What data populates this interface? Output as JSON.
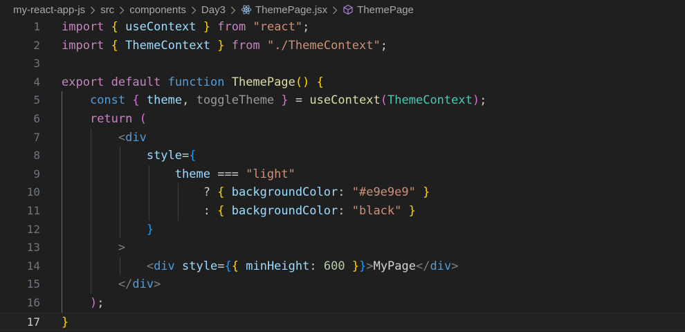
{
  "breadcrumb": {
    "items": [
      "my-react-app-js",
      "src",
      "components",
      "Day3",
      "ThemePage.jsx",
      "ThemePage"
    ]
  },
  "editor": {
    "current_line": 17,
    "lines": [
      {
        "num": "1",
        "tokens": [
          [
            "kw",
            "import"
          ],
          [
            "txt",
            " "
          ],
          [
            "b1",
            "{"
          ],
          [
            "txt",
            " "
          ],
          [
            "var",
            "useContext"
          ],
          [
            "txt",
            " "
          ],
          [
            "b1",
            "}"
          ],
          [
            "txt",
            " "
          ],
          [
            "kw",
            "from"
          ],
          [
            "txt",
            " "
          ],
          [
            "str",
            "\"react\""
          ],
          [
            "punc",
            ";"
          ]
        ]
      },
      {
        "num": "2",
        "tokens": [
          [
            "kw",
            "import"
          ],
          [
            "txt",
            " "
          ],
          [
            "b1",
            "{"
          ],
          [
            "txt",
            " "
          ],
          [
            "var",
            "ThemeContext"
          ],
          [
            "txt",
            " "
          ],
          [
            "b1",
            "}"
          ],
          [
            "txt",
            " "
          ],
          [
            "kw",
            "from"
          ],
          [
            "txt",
            " "
          ],
          [
            "str",
            "\"./ThemeContext\""
          ],
          [
            "punc",
            ";"
          ]
        ]
      },
      {
        "num": "3",
        "tokens": []
      },
      {
        "num": "4",
        "tokens": [
          [
            "kw",
            "export"
          ],
          [
            "txt",
            " "
          ],
          [
            "kw",
            "default"
          ],
          [
            "txt",
            " "
          ],
          [
            "kwb",
            "function"
          ],
          [
            "txt",
            " "
          ],
          [
            "fn",
            "ThemePage"
          ],
          [
            "b1",
            "()"
          ],
          [
            "txt",
            " "
          ],
          [
            "b1",
            "{"
          ]
        ]
      },
      {
        "num": "5",
        "tokens": [
          [
            "txt",
            "    "
          ],
          [
            "kwb",
            "const"
          ],
          [
            "txt",
            " "
          ],
          [
            "b2",
            "{"
          ],
          [
            "txt",
            " "
          ],
          [
            "var",
            "theme"
          ],
          [
            "punc",
            ","
          ],
          [
            "txt",
            " "
          ],
          [
            "dim",
            "toggleTheme"
          ],
          [
            "txt",
            " "
          ],
          [
            "b2",
            "}"
          ],
          [
            "txt",
            " "
          ],
          [
            "punc",
            "="
          ],
          [
            "txt",
            " "
          ],
          [
            "fn",
            "useContext"
          ],
          [
            "b2",
            "("
          ],
          [
            "cls",
            "ThemeContext"
          ],
          [
            "b2",
            ")"
          ],
          [
            "punc",
            ";"
          ]
        ]
      },
      {
        "num": "6",
        "tokens": [
          [
            "txt",
            "    "
          ],
          [
            "kw",
            "return"
          ],
          [
            "txt",
            " "
          ],
          [
            "b2",
            "("
          ]
        ]
      },
      {
        "num": "7",
        "tokens": [
          [
            "txt",
            "        "
          ],
          [
            "tag",
            "<"
          ],
          [
            "tagn",
            "div"
          ]
        ]
      },
      {
        "num": "8",
        "tokens": [
          [
            "txt",
            "            "
          ],
          [
            "attr",
            "style"
          ],
          [
            "punc",
            "="
          ],
          [
            "b3",
            "{"
          ]
        ]
      },
      {
        "num": "9",
        "tokens": [
          [
            "txt",
            "                "
          ],
          [
            "var",
            "theme"
          ],
          [
            "txt",
            " "
          ],
          [
            "punc",
            "==="
          ],
          [
            "txt",
            " "
          ],
          [
            "str",
            "\"light\""
          ]
        ]
      },
      {
        "num": "10",
        "tokens": [
          [
            "txt",
            "                    "
          ],
          [
            "punc",
            "?"
          ],
          [
            "txt",
            " "
          ],
          [
            "b1",
            "{"
          ],
          [
            "txt",
            " "
          ],
          [
            "var",
            "backgroundColor"
          ],
          [
            "punc",
            ":"
          ],
          [
            "txt",
            " "
          ],
          [
            "str",
            "\"#e9e9e9\""
          ],
          [
            "txt",
            " "
          ],
          [
            "b1",
            "}"
          ]
        ]
      },
      {
        "num": "11",
        "tokens": [
          [
            "txt",
            "                    "
          ],
          [
            "punc",
            ":"
          ],
          [
            "txt",
            " "
          ],
          [
            "b1",
            "{"
          ],
          [
            "txt",
            " "
          ],
          [
            "var",
            "backgroundColor"
          ],
          [
            "punc",
            ":"
          ],
          [
            "txt",
            " "
          ],
          [
            "str",
            "\"black\""
          ],
          [
            "txt",
            " "
          ],
          [
            "b1",
            "}"
          ]
        ]
      },
      {
        "num": "12",
        "tokens": [
          [
            "txt",
            "            "
          ],
          [
            "b3",
            "}"
          ]
        ]
      },
      {
        "num": "13",
        "tokens": [
          [
            "txt",
            "        "
          ],
          [
            "tag",
            ">"
          ]
        ]
      },
      {
        "num": "14",
        "tokens": [
          [
            "txt",
            "            "
          ],
          [
            "tag",
            "<"
          ],
          [
            "tagn",
            "div"
          ],
          [
            "txt",
            " "
          ],
          [
            "attr",
            "style"
          ],
          [
            "punc",
            "="
          ],
          [
            "b3",
            "{"
          ],
          [
            "b1",
            "{"
          ],
          [
            "txt",
            " "
          ],
          [
            "var",
            "minHeight"
          ],
          [
            "punc",
            ":"
          ],
          [
            "txt",
            " "
          ],
          [
            "num",
            "600"
          ],
          [
            "txt",
            " "
          ],
          [
            "b1",
            "}"
          ],
          [
            "b3",
            "}"
          ],
          [
            "tag",
            ">"
          ],
          [
            "txt",
            "MyPage"
          ],
          [
            "tag",
            "</"
          ],
          [
            "tagn",
            "div"
          ],
          [
            "tag",
            ">"
          ]
        ]
      },
      {
        "num": "15",
        "tokens": [
          [
            "txt",
            "        "
          ],
          [
            "tag",
            "</"
          ],
          [
            "tagn",
            "div"
          ],
          [
            "tag",
            ">"
          ]
        ]
      },
      {
        "num": "16",
        "tokens": [
          [
            "txt",
            "    "
          ],
          [
            "b2",
            ")"
          ],
          [
            "punc",
            ";"
          ]
        ]
      },
      {
        "num": "17",
        "tokens": [
          [
            "b1",
            "}"
          ]
        ]
      }
    ]
  }
}
